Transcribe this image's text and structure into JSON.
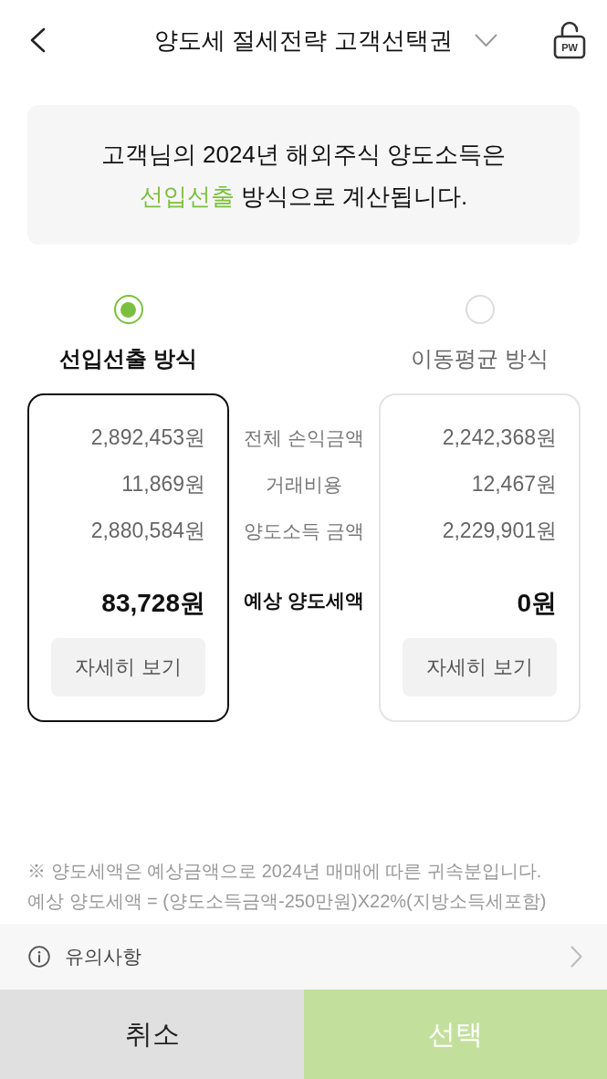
{
  "header": {
    "title": "양도세 절세전략 고객선택권",
    "lock_label": "PW"
  },
  "notice": {
    "lines": [
      [
        {
          "text": "고객님의 2024년 해외주식 양도소득은",
          "highlight": false
        }
      ],
      [
        {
          "text": "선입선출",
          "highlight": true
        },
        {
          "text": " 방식으로 계산됩니다.",
          "highlight": false
        }
      ]
    ]
  },
  "methods": [
    {
      "label": "선입선출 방식",
      "selected": true,
      "values": [
        "2,892,453원",
        "11,869원",
        "2,880,584원"
      ],
      "tax": "83,728원",
      "detail_button": "자세히 보기"
    },
    {
      "label": "이동평균 방식",
      "selected": false,
      "values": [
        "2,242,368원",
        "12,467원",
        "2,229,901원"
      ],
      "tax": "0원",
      "detail_button": "자세히 보기"
    }
  ],
  "row_labels": [
    "전체 손익금액",
    "거래비용",
    "양도소득 금액"
  ],
  "tax_label": "예상 양도세액",
  "notes": [
    "※ 양도세액은 예상금액으로 2024년 매매에 따른 귀속분입니다.",
    "예상 양도세액 = (양도소득금액-250만원)X22%(지방소득세포함)"
  ],
  "caution": {
    "label": "유의사항"
  },
  "buttons": [
    {
      "label": "취소",
      "kind": "cancel"
    },
    {
      "label": "선택",
      "kind": "confirm"
    }
  ]
}
